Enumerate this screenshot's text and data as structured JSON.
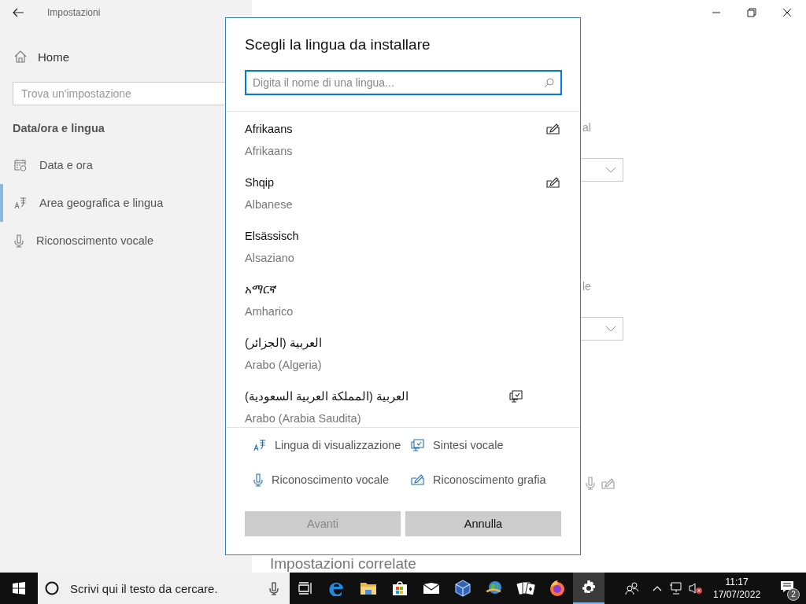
{
  "window": {
    "title": "Impostazioni"
  },
  "sidebar": {
    "home": "Home",
    "search": {
      "placeholder": "Trova un'impostazione"
    },
    "section": "Data/ora e lingua",
    "items": [
      {
        "label": "Data e ora",
        "kind": "calendar",
        "selected": false
      },
      {
        "label": "Area geografica e lingua",
        "kind": "language",
        "selected": true
      },
      {
        "label": "Riconoscimento vocale",
        "kind": "mic",
        "selected": false
      }
    ]
  },
  "background": {
    "fragments": [
      "al",
      "le"
    ],
    "related_heading": "Impostazioni correlate"
  },
  "dialog": {
    "title": "Scegli la lingua da installare",
    "search": {
      "placeholder": "Digita il nome di una lingua..."
    },
    "languages": [
      {
        "name": "Afrikaans",
        "translation": "Afrikaans",
        "features": [
          {
            "kind": "handwriting"
          }
        ]
      },
      {
        "name": "Shqip",
        "translation": "Albanese",
        "features": [
          {
            "kind": "handwriting"
          }
        ]
      },
      {
        "name": "Elsässisch",
        "translation": "Alsaziano"
      },
      {
        "name": "አማርኛ",
        "translation": "Amharico"
      },
      {
        "name": "العربية (الجزائر)",
        "translation": "Arabo (Algeria)"
      },
      {
        "name": "العربية (المملكة العربية السعودية)",
        "translation": "Arabo (Arabia Saudita)",
        "features": [
          {
            "kind": "tts"
          }
        ]
      }
    ],
    "legend": [
      {
        "kind": "display",
        "label": "Lingua di visualizzazione"
      },
      {
        "kind": "tts",
        "label": "Sintesi vocale"
      },
      {
        "kind": "speech",
        "label": "Riconoscimento vocale"
      },
      {
        "kind": "handwriting",
        "label": "Riconoscimento grafia"
      }
    ],
    "buttons": [
      {
        "label": "Avanti",
        "disabled": true
      },
      {
        "label": "Annulla",
        "disabled": false
      }
    ]
  },
  "taskbar": {
    "search": {
      "placeholder": "Scrivi qui il testo da cercare."
    },
    "apps": [
      {
        "kind": "task-view",
        "selected": false
      },
      {
        "kind": "browser-e",
        "selected": false
      },
      {
        "kind": "folder",
        "selected": false
      },
      {
        "kind": "store",
        "selected": false
      },
      {
        "kind": "mail",
        "selected": false
      },
      {
        "kind": "cube",
        "selected": false
      },
      {
        "kind": "globe",
        "selected": false
      },
      {
        "kind": "cards",
        "selected": false
      },
      {
        "kind": "fox",
        "selected": false
      },
      {
        "kind": "gear",
        "selected": true
      }
    ],
    "clock": {
      "time": "11:17",
      "date": "17/07/2022"
    },
    "notifications": "2"
  }
}
